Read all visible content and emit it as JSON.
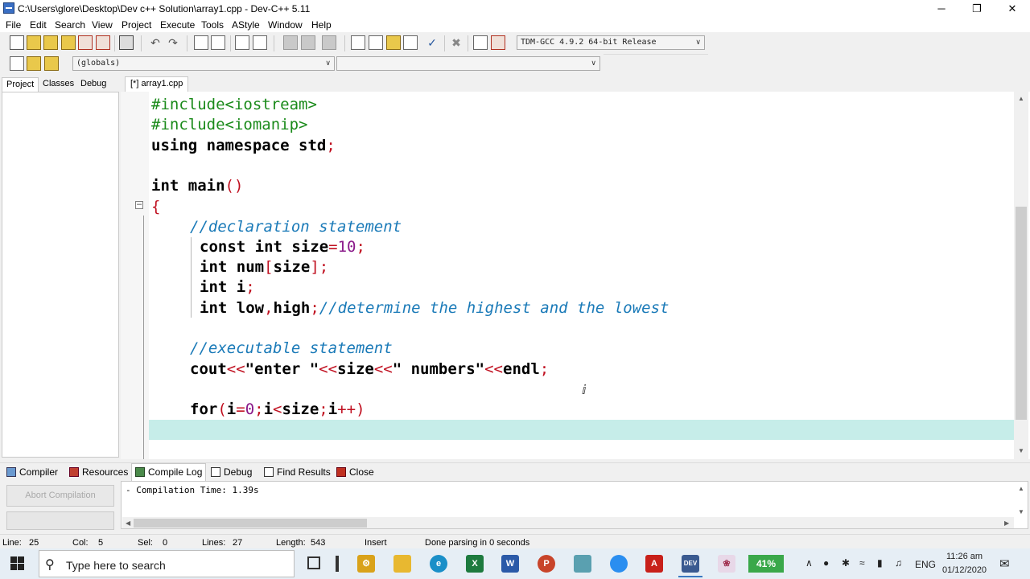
{
  "window": {
    "title": "C:\\Users\\glore\\Desktop\\Dev c++ Solution\\array1.cpp - Dev-C++ 5.11",
    "minimize": "─",
    "maximize": "❐",
    "close": "✕"
  },
  "menu": [
    "File",
    "Edit",
    "Search",
    "View",
    "Project",
    "Execute",
    "Tools",
    "AStyle",
    "Window",
    "Help"
  ],
  "toolbar": {
    "compiler_select": "TDM-GCC 4.9.2 64-bit Release",
    "globals_select": "(globals)",
    "member_select": ""
  },
  "left_tabs": [
    "Project",
    "Classes",
    "Debug"
  ],
  "file_tab": "[*] array1.cpp",
  "code": {
    "l1": "#include<iostream>",
    "l2": "#include<iomanip>",
    "l3_kw": "using namespace",
    "l3_rest": " std",
    "l3_semi": ";",
    "l5_kw": "int",
    "l5_name": " main",
    "l5_paren": "()",
    "l6": "{",
    "l7": "//declaration statement",
    "l8_kw": "const int",
    "l8_name": " size",
    "l8_eq": "=",
    "l8_num": "10",
    "l8_semi": ";",
    "l9_kw": "int",
    "l9_name": " num",
    "l9_br1": "[",
    "l9_mid": "size",
    "l9_br2": "];",
    "l10_kw": "int",
    "l10_name": " i",
    "l10_semi": ";",
    "l11_kw": "int",
    "l11_a": " low",
    "l11_c": ",",
    "l11_b": "high",
    "l11_semi": ";",
    "l11_cm": "//determine the highest and the lowest",
    "l13": "//executable statement",
    "l14_a": "cout",
    "l14_op1": "<<",
    "l14_s1": "\"enter \"",
    "l14_op2": "<<",
    "l14_b": "size",
    "l14_op3": "<<",
    "l14_s2": "\" numbers\"",
    "l14_op4": "<<",
    "l14_c": "endl",
    "l14_semi": ";",
    "l16_kw": "for",
    "l16_p1": "(",
    "l16_a": "i",
    "l16_eq": "=",
    "l16_n": "0",
    "l16_s1": ";",
    "l16_b": "i",
    "l16_lt": "<",
    "l16_c": "size",
    "l16_s2": ";",
    "l16_d": "i",
    "l16_pp": "++",
    "l16_p2": ")"
  },
  "bottom_tabs": [
    "Compiler",
    "Resources",
    "Compile Log",
    "Debug",
    "Find Results",
    "Close"
  ],
  "abort_button": "Abort Compilation",
  "log_text": "- Compilation Time: 1.39s",
  "status": {
    "line_label": "Line:",
    "line": "25",
    "col_label": "Col:",
    "col": "5",
    "sel_label": "Sel:",
    "sel": "0",
    "lines_label": "Lines:",
    "lines": "27",
    "length_label": "Length:",
    "length": "543",
    "mode": "Insert",
    "message": "Done parsing in 0 seconds"
  },
  "taskbar": {
    "search_placeholder": "Type here to search",
    "battery": "41%",
    "lang": "ENG",
    "time": "11:26 am",
    "date": "01/12/2020"
  },
  "colors": {
    "current_line": "#c6ede9",
    "include": "#1a8a1a",
    "comment": "#1a7ab8",
    "number": "#8a1a8a",
    "operator": "#c01020"
  }
}
